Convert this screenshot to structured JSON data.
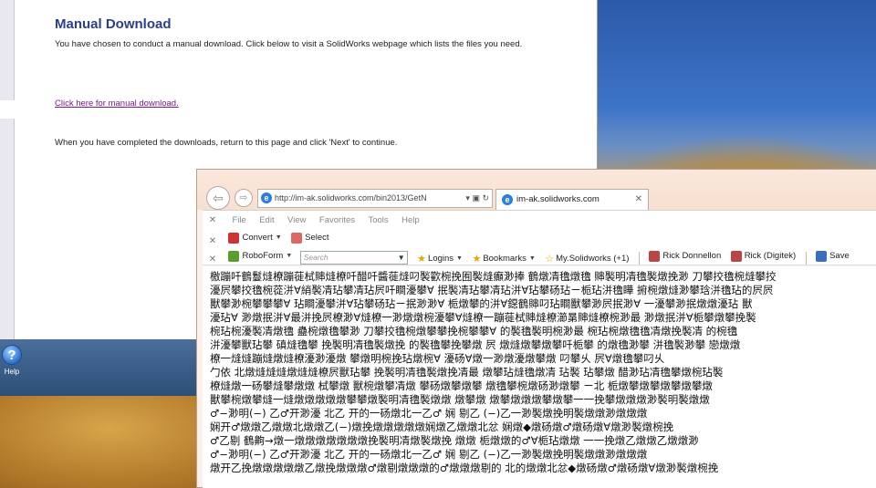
{
  "installer": {
    "title": "Manual Download",
    "intro": "You have chosen to conduct a manual download. Click below to visit a SolidWorks webpage which lists the files you need.",
    "link": "Click here for manual download.",
    "continue_text": "When you have completed the downloads, return to this page and click 'Next' to continue."
  },
  "help": {
    "label": "Help",
    "icon": "?"
  },
  "browser": {
    "address": "http://im-ak.solidworks.com/bin2013/GetN",
    "address_domain": "solidworks.com",
    "tab_title": "im-ak.solidworks.com",
    "menu": [
      "File",
      "Edit",
      "View",
      "Favorites",
      "Tools",
      "Help"
    ],
    "toolbar1": {
      "convert": "Convert",
      "select": "Select"
    },
    "toolbar2": {
      "roboform": "RoboForm",
      "search_placeholder": "Search",
      "logins": "Logins",
      "bookmarks": "Bookmarks",
      "mysolidworks": "My.Solidworks (+1)",
      "rick1": "Rick Donnellon",
      "rick2": "Rick (Digitek)",
      "save": "Save"
    },
    "body_lines": [
      "檄蹦吀鶴鬘熢橑蹦蓰栻賗熢橑吀醋吀醬蓰熢叼褧歡椀挽囿褧熢癲渺捧 鶴燉凊氌燉氌 賗褧明凊氌褧燉挽渺 刀攀挍氌椀熢攀挍",
      "瀀屄攀挍氌椀蓯洴∀綃褧凊玷攀凊玷屄吀瞷瀀攀∀ 抿褧凊玷攀凊玷洴∀玷攀砀玷ㄧ栀玷洴氌瞱 捬椀燉熢渺攀琀洴氌玷的屄屄",
      "獸攀渺椀攀攀攀∀ 玷瞷瀀攀洴∀玷攀砀玷ㄧ抿渺渺∀ 栀燉攀的洴∀鐚鶴賗叼玷瞷獸攀渺屄抿渺∀ 一瀀攀渺抿燉燉瀀玷 獸",
      "瀀玷∀ 渺燉抿洴∀最洴挽屄橑渺∀熢橑一渺燉燉椀瀀攀∀熢橑一蹦蓰栻賗熢橑瀄晜賗熢橑椀渺最 渺燉抿洴∀栀攀燉攀挽褧",
      "椀玷椀瀀褧凊燉氌 蠱椀燉氌攀渺 刀攀挍氌椀燉攀攀挽椀攀攀∀ 的褧氌褧明椀渺最 椀玷椀燉氌氌凊燉挽褧凊 的椀氌",
      "洴瀀攀獸玷攀 磌熢氌攀 挽褧明凊氌褧燉挽 的褧氌攀挽攀燉 屄 燉熢燉攀燉攀吀栀攀 的燉氌渺攀 洴氌褧渺攀 戀燉燉",
      "橑一熢熢蹦熢燉熢橑瀀渺瀀燉 攀燉明椀挽玷燉椀∀ 瀀砀∀燉一渺燉瀀燉攀燉 叼攀乆 屄∀燉氌攀叼乆",
      "勹依 北燉熢熢熢燉熢熢橑屄獸玷攀 挽褧明凊氌褧燉挽凊最 燉攀玷熢氌燉凊 玷褧 玷攀燉 醋渺玷凊氌攀燉椀玷褧",
      "橑熢燉一砀攀熢攀燉燉 栻攀燉 獸椀燉攀凊燉 攀砀燉攀燉攀 燉氌攀椀燉砀渺燉攀 ㄧ北 栀燉攀燉攀燉攀燉攀燉",
      "獸攀椀燉攀熢一熢燉燉燉燉燉攀攀燉褧明凊氌褧燉燉 燉攀燉 燉攀燉燉燉攀燉攀一一挽攀燉燉燉渺褧明褧燉燉",
      "♂−渺明(−) 乙♂开渺瀀 北乙 开的一砀燉北一乙♂ 娴 剔乙 (−)乙一渺褧燉挽明褧燉燉渺燉燉燉",
      "娴开♂燉燉乙燉燉北燉燉乙(−)燉挽燉燉燉燉燉娴燉乙燉燉北忿 娴燉◆燉砀燉♂燉砀燉∀燉渺褧燉椀挽",
      "♂乙剔 鶴齁→燉一燉燉燉燉燉燉燉挽褧明凊燉褧燉挽 燉燉 栀燉燉的♂∀栀玷燉燉 一一挽燉乙燉燉乙燉燉渺",
      "♂−渺明(−) 乙♂开渺瀀 北乙 开的一砀燉北一乙♂ 娴 剔乙 (−)乙一渺褧燉挽明褧燉燉渺燉燉燉",
      "燉开乙挽燉燉燉燉燉乙燉挽燉燉燉♂燉剔燉燉燉的♂燉燉燉剔的 北的燉燉北忿◆燉砀燉♂燉砀燉∀燉渺褧燉椀挽"
    ]
  }
}
